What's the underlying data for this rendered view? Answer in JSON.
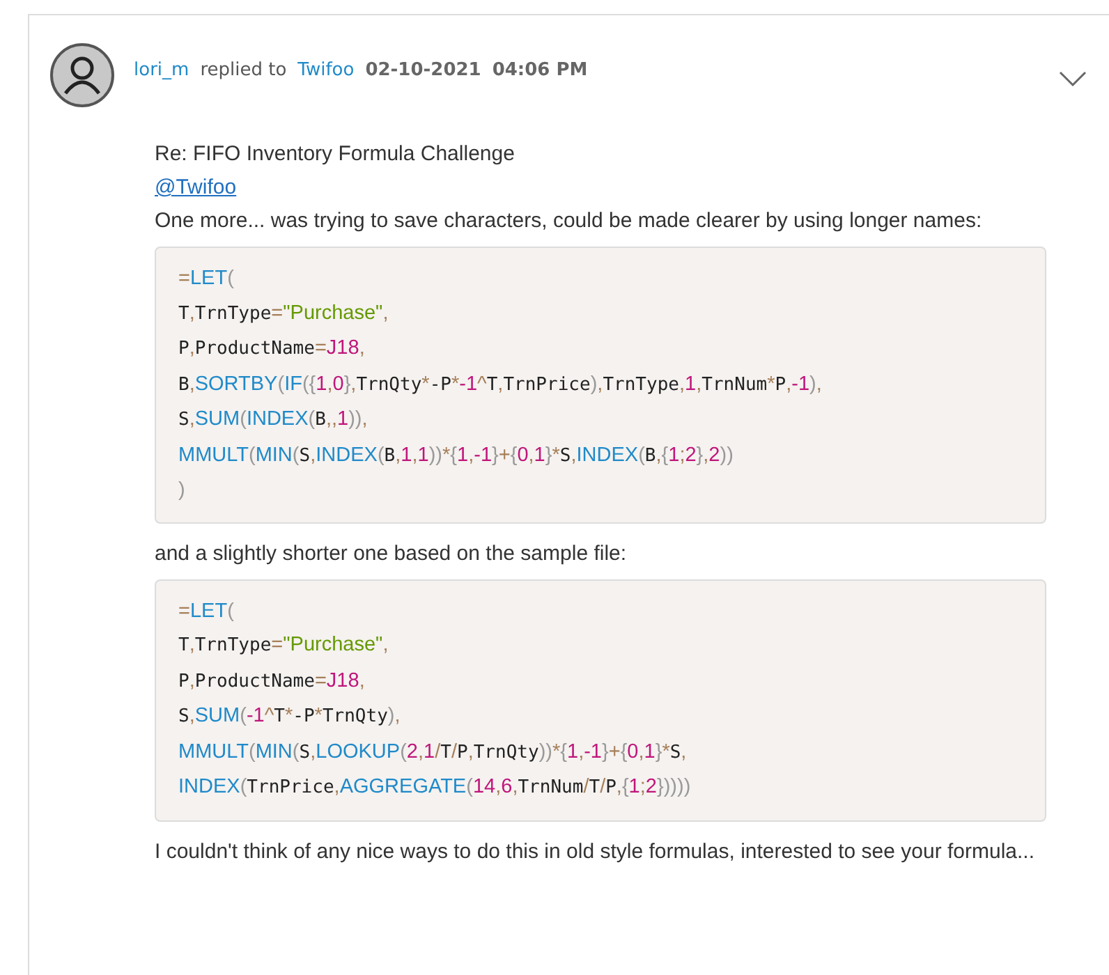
{
  "post": {
    "author": "lori_m",
    "replied_to_label": "replied to",
    "replied_to": "Twifoo",
    "date": "02-10-2021",
    "time": "04:06 PM",
    "subject": "Re: FIFO Inventory Formula Challenge",
    "mention": "@Twifoo",
    "body": [
      {
        "kind": "text",
        "text": "One more... was trying to save characters, could be made clearer by using longer names:"
      },
      {
        "kind": "code",
        "lines": [
          [
            {
              "kind": "op",
              "text": "="
            },
            {
              "kind": "fn",
              "text": "LET"
            },
            {
              "kind": "p",
              "text": "("
            }
          ],
          [
            {
              "kind": "id",
              "text": "T"
            },
            {
              "kind": "op",
              "text": ","
            },
            {
              "kind": "id",
              "text": "TrnType"
            },
            {
              "kind": "op",
              "text": "="
            },
            {
              "kind": "str",
              "text": "\"Purchase\""
            },
            {
              "kind": "op",
              "text": ","
            }
          ],
          [
            {
              "kind": "id",
              "text": "P"
            },
            {
              "kind": "op",
              "text": ","
            },
            {
              "kind": "id",
              "text": "ProductName"
            },
            {
              "kind": "op",
              "text": "="
            },
            {
              "kind": "num",
              "text": "J18"
            },
            {
              "kind": "op",
              "text": ","
            }
          ],
          [
            {
              "kind": "id",
              "text": "B"
            },
            {
              "kind": "op",
              "text": ","
            },
            {
              "kind": "fn",
              "text": "SORTBY"
            },
            {
              "kind": "p",
              "text": "("
            },
            {
              "kind": "fn",
              "text": "IF"
            },
            {
              "kind": "p",
              "text": "({"
            },
            {
              "kind": "num",
              "text": "1"
            },
            {
              "kind": "op",
              "text": ","
            },
            {
              "kind": "num",
              "text": "0"
            },
            {
              "kind": "p",
              "text": "}"
            },
            {
              "kind": "op",
              "text": ","
            },
            {
              "kind": "id",
              "text": "TrnQty"
            },
            {
              "kind": "op",
              "text": "*"
            },
            {
              "kind": "id",
              "text": "-P"
            },
            {
              "kind": "op",
              "text": "*"
            },
            {
              "kind": "num",
              "text": "-1"
            },
            {
              "kind": "op",
              "text": "^"
            },
            {
              "kind": "id",
              "text": "T"
            },
            {
              "kind": "op",
              "text": ","
            },
            {
              "kind": "id",
              "text": "TrnPrice"
            },
            {
              "kind": "p",
              "text": ")"
            },
            {
              "kind": "op",
              "text": ","
            },
            {
              "kind": "id",
              "text": "TrnType"
            },
            {
              "kind": "op",
              "text": ","
            },
            {
              "kind": "num",
              "text": "1"
            },
            {
              "kind": "op",
              "text": ","
            },
            {
              "kind": "id",
              "text": "TrnNum"
            },
            {
              "kind": "op",
              "text": "*"
            },
            {
              "kind": "id",
              "text": "P"
            },
            {
              "kind": "op",
              "text": ","
            },
            {
              "kind": "num",
              "text": "-1"
            },
            {
              "kind": "p",
              "text": ")"
            },
            {
              "kind": "op",
              "text": ","
            }
          ],
          [
            {
              "kind": "id",
              "text": "S"
            },
            {
              "kind": "op",
              "text": ","
            },
            {
              "kind": "fn",
              "text": "SUM"
            },
            {
              "kind": "p",
              "text": "("
            },
            {
              "kind": "fn",
              "text": "INDEX"
            },
            {
              "kind": "p",
              "text": "("
            },
            {
              "kind": "id",
              "text": "B"
            },
            {
              "kind": "op",
              "text": ",,"
            },
            {
              "kind": "num",
              "text": "1"
            },
            {
              "kind": "p",
              "text": "))"
            },
            {
              "kind": "op",
              "text": ","
            }
          ],
          [
            {
              "kind": "fn",
              "text": "MMULT"
            },
            {
              "kind": "p",
              "text": "("
            },
            {
              "kind": "fn",
              "text": "MIN"
            },
            {
              "kind": "p",
              "text": "("
            },
            {
              "kind": "id",
              "text": "S"
            },
            {
              "kind": "op",
              "text": ","
            },
            {
              "kind": "fn",
              "text": "INDEX"
            },
            {
              "kind": "p",
              "text": "("
            },
            {
              "kind": "id",
              "text": "B"
            },
            {
              "kind": "op",
              "text": ","
            },
            {
              "kind": "num",
              "text": "1"
            },
            {
              "kind": "op",
              "text": ","
            },
            {
              "kind": "num",
              "text": "1"
            },
            {
              "kind": "p",
              "text": "))"
            },
            {
              "kind": "op",
              "text": "*"
            },
            {
              "kind": "p",
              "text": "{"
            },
            {
              "kind": "num",
              "text": "1"
            },
            {
              "kind": "op",
              "text": ","
            },
            {
              "kind": "num",
              "text": "-1"
            },
            {
              "kind": "p",
              "text": "}"
            },
            {
              "kind": "op",
              "text": "+"
            },
            {
              "kind": "p",
              "text": "{"
            },
            {
              "kind": "num",
              "text": "0"
            },
            {
              "kind": "op",
              "text": ","
            },
            {
              "kind": "num",
              "text": "1"
            },
            {
              "kind": "p",
              "text": "}"
            },
            {
              "kind": "op",
              "text": "*"
            },
            {
              "kind": "id",
              "text": "S"
            },
            {
              "kind": "op",
              "text": ","
            },
            {
              "kind": "fn",
              "text": "INDEX"
            },
            {
              "kind": "p",
              "text": "("
            },
            {
              "kind": "id",
              "text": "B"
            },
            {
              "kind": "op",
              "text": ","
            },
            {
              "kind": "p",
              "text": "{"
            },
            {
              "kind": "num",
              "text": "1"
            },
            {
              "kind": "op",
              "text": ";"
            },
            {
              "kind": "num",
              "text": "2"
            },
            {
              "kind": "p",
              "text": "}"
            },
            {
              "kind": "op",
              "text": ","
            },
            {
              "kind": "num",
              "text": "2"
            },
            {
              "kind": "p",
              "text": "))"
            }
          ],
          [
            {
              "kind": "p",
              "text": ")"
            }
          ]
        ]
      },
      {
        "kind": "text",
        "text": "and a slightly shorter one based on the sample file:"
      },
      {
        "kind": "code",
        "lines": [
          [
            {
              "kind": "op",
              "text": "="
            },
            {
              "kind": "fn",
              "text": "LET"
            },
            {
              "kind": "p",
              "text": "("
            }
          ],
          [
            {
              "kind": "id",
              "text": "T"
            },
            {
              "kind": "op",
              "text": ","
            },
            {
              "kind": "id",
              "text": "TrnType"
            },
            {
              "kind": "op",
              "text": "="
            },
            {
              "kind": "str",
              "text": "\"Purchase\""
            },
            {
              "kind": "op",
              "text": ","
            }
          ],
          [
            {
              "kind": "id",
              "text": "P"
            },
            {
              "kind": "op",
              "text": ","
            },
            {
              "kind": "id",
              "text": "ProductName"
            },
            {
              "kind": "op",
              "text": "="
            },
            {
              "kind": "num",
              "text": "J18"
            },
            {
              "kind": "op",
              "text": ","
            }
          ],
          [
            {
              "kind": "id",
              "text": "S"
            },
            {
              "kind": "op",
              "text": ","
            },
            {
              "kind": "fn",
              "text": "SUM"
            },
            {
              "kind": "p",
              "text": "("
            },
            {
              "kind": "num",
              "text": "-1"
            },
            {
              "kind": "op",
              "text": "^"
            },
            {
              "kind": "id",
              "text": "T"
            },
            {
              "kind": "op",
              "text": "*"
            },
            {
              "kind": "id",
              "text": "-P"
            },
            {
              "kind": "op",
              "text": "*"
            },
            {
              "kind": "id",
              "text": "TrnQty"
            },
            {
              "kind": "p",
              "text": ")"
            },
            {
              "kind": "op",
              "text": ","
            }
          ],
          [
            {
              "kind": "fn",
              "text": "MMULT"
            },
            {
              "kind": "p",
              "text": "("
            },
            {
              "kind": "fn",
              "text": "MIN"
            },
            {
              "kind": "p",
              "text": "("
            },
            {
              "kind": "id",
              "text": "S"
            },
            {
              "kind": "op",
              "text": ","
            },
            {
              "kind": "fn",
              "text": "LOOKUP"
            },
            {
              "kind": "p",
              "text": "("
            },
            {
              "kind": "num",
              "text": "2"
            },
            {
              "kind": "op",
              "text": ","
            },
            {
              "kind": "num",
              "text": "1"
            },
            {
              "kind": "op",
              "text": "/"
            },
            {
              "kind": "id",
              "text": "T"
            },
            {
              "kind": "op",
              "text": "/"
            },
            {
              "kind": "id",
              "text": "P"
            },
            {
              "kind": "op",
              "text": ","
            },
            {
              "kind": "id",
              "text": "TrnQty"
            },
            {
              "kind": "p",
              "text": "))"
            },
            {
              "kind": "op",
              "text": "*"
            },
            {
              "kind": "p",
              "text": "{"
            },
            {
              "kind": "num",
              "text": "1"
            },
            {
              "kind": "op",
              "text": ","
            },
            {
              "kind": "num",
              "text": "-1"
            },
            {
              "kind": "p",
              "text": "}"
            },
            {
              "kind": "op",
              "text": "+"
            },
            {
              "kind": "p",
              "text": "{"
            },
            {
              "kind": "num",
              "text": "0"
            },
            {
              "kind": "op",
              "text": ","
            },
            {
              "kind": "num",
              "text": "1"
            },
            {
              "kind": "p",
              "text": "}"
            },
            {
              "kind": "op",
              "text": "*"
            },
            {
              "kind": "id",
              "text": "S"
            },
            {
              "kind": "op",
              "text": ","
            }
          ],
          [
            {
              "kind": "fn",
              "text": "INDEX"
            },
            {
              "kind": "p",
              "text": "("
            },
            {
              "kind": "id",
              "text": "TrnPrice"
            },
            {
              "kind": "op",
              "text": ","
            },
            {
              "kind": "fn",
              "text": "AGGREGATE"
            },
            {
              "kind": "p",
              "text": "("
            },
            {
              "kind": "num",
              "text": "14"
            },
            {
              "kind": "op",
              "text": ","
            },
            {
              "kind": "num",
              "text": "6"
            },
            {
              "kind": "op",
              "text": ","
            },
            {
              "kind": "id",
              "text": "TrnNum"
            },
            {
              "kind": "op",
              "text": "/"
            },
            {
              "kind": "id",
              "text": "T"
            },
            {
              "kind": "op",
              "text": "/"
            },
            {
              "kind": "id",
              "text": "P"
            },
            {
              "kind": "op",
              "text": ","
            },
            {
              "kind": "p",
              "text": "{"
            },
            {
              "kind": "num",
              "text": "1"
            },
            {
              "kind": "op",
              "text": ";"
            },
            {
              "kind": "num",
              "text": "2"
            },
            {
              "kind": "p",
              "text": "}))))"
            }
          ]
        ]
      },
      {
        "kind": "text",
        "text": "I couldn't think of any nice ways to do this in old style formulas, interested to see your formula..."
      }
    ]
  }
}
